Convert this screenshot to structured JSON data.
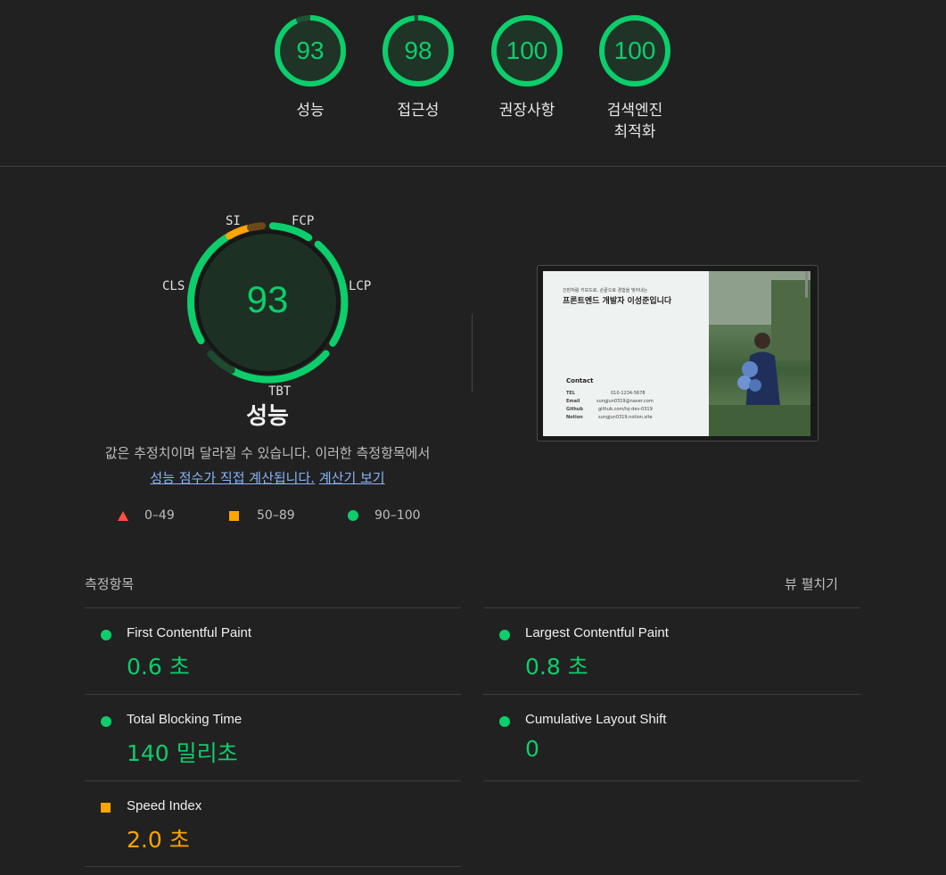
{
  "categories": [
    {
      "score": "93",
      "label": "성능"
    },
    {
      "score": "98",
      "label": "접근성"
    },
    {
      "score": "100",
      "label": "권장사항"
    },
    {
      "score": "100",
      "label": "검색엔진",
      "label2": "최적화"
    }
  ],
  "performance": {
    "score": "93",
    "title": "성능",
    "tags": {
      "si": "SI",
      "fcp": "FCP",
      "cls": "CLS",
      "lcp": "LCP",
      "tbt": "TBT"
    },
    "desc_line1": "값은 추정치이며 달라질 수 있습니다. 이러한 측정항목에서",
    "link1": "성능 점수가 직접 계산됩니다.",
    "link2": "계산기 보기",
    "legend": {
      "fail": "0–49",
      "average": "50–89",
      "pass": "90–100"
    }
  },
  "thumbnail": {
    "tagline": "간판처럼 키보드로, 손끝으로 경험을 빚어내는",
    "title": "프론트엔드 개발자 이성준입니다",
    "contact": "Contact",
    "rows": [
      {
        "k": "TEL",
        "v": "010-1234-5678"
      },
      {
        "k": "Email",
        "v": "sungjun0319@naver.com"
      },
      {
        "k": "Github",
        "v": "github.com/lsj-dev-0319"
      },
      {
        "k": "Notion",
        "v": "sungjun0319.notion.site"
      }
    ]
  },
  "metrics": {
    "heading": "측정항목",
    "expand": "뷰 펼치기",
    "items": [
      {
        "name": "First Contentful Paint",
        "value": "0.6 초",
        "status": "pass"
      },
      {
        "name": "Largest Contentful Paint",
        "value": "0.8 초",
        "status": "pass"
      },
      {
        "name": "Total Blocking Time",
        "value": "140 밀리초",
        "status": "pass"
      },
      {
        "name": "Cumulative Layout Shift",
        "value": "0",
        "status": "pass"
      },
      {
        "name": "Speed Index",
        "value": "2.0 초",
        "status": "average"
      }
    ]
  },
  "colors": {
    "pass": "#0cce6b",
    "average": "#ffa400",
    "fail": "#ff4e42",
    "background": "#212121"
  }
}
